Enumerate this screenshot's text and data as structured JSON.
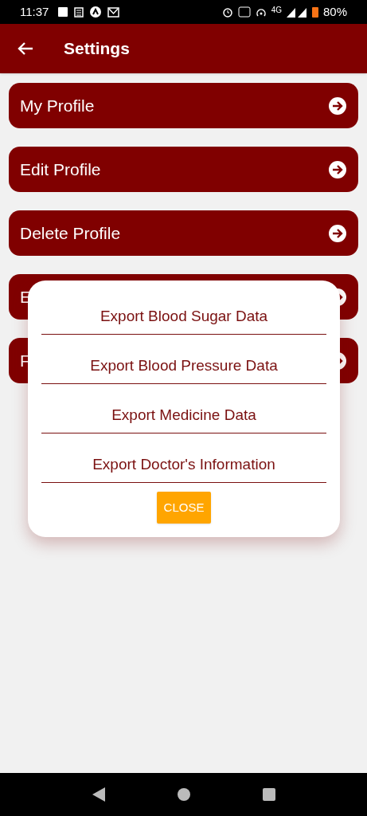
{
  "status_bar": {
    "time": "11:37",
    "network": "4G",
    "battery": "80%"
  },
  "app_bar": {
    "title": "Settings"
  },
  "menu_items": [
    {
      "label": "My Profile"
    },
    {
      "label": "Edit Profile"
    },
    {
      "label": "Delete Profile"
    },
    {
      "label": "E"
    },
    {
      "label": "F"
    }
  ],
  "dialog": {
    "options": [
      "Export Blood Sugar Data",
      "Export Blood Pressure Data",
      "Export Medicine Data",
      "Export Doctor's Information"
    ],
    "close_button": "CLOSE"
  }
}
